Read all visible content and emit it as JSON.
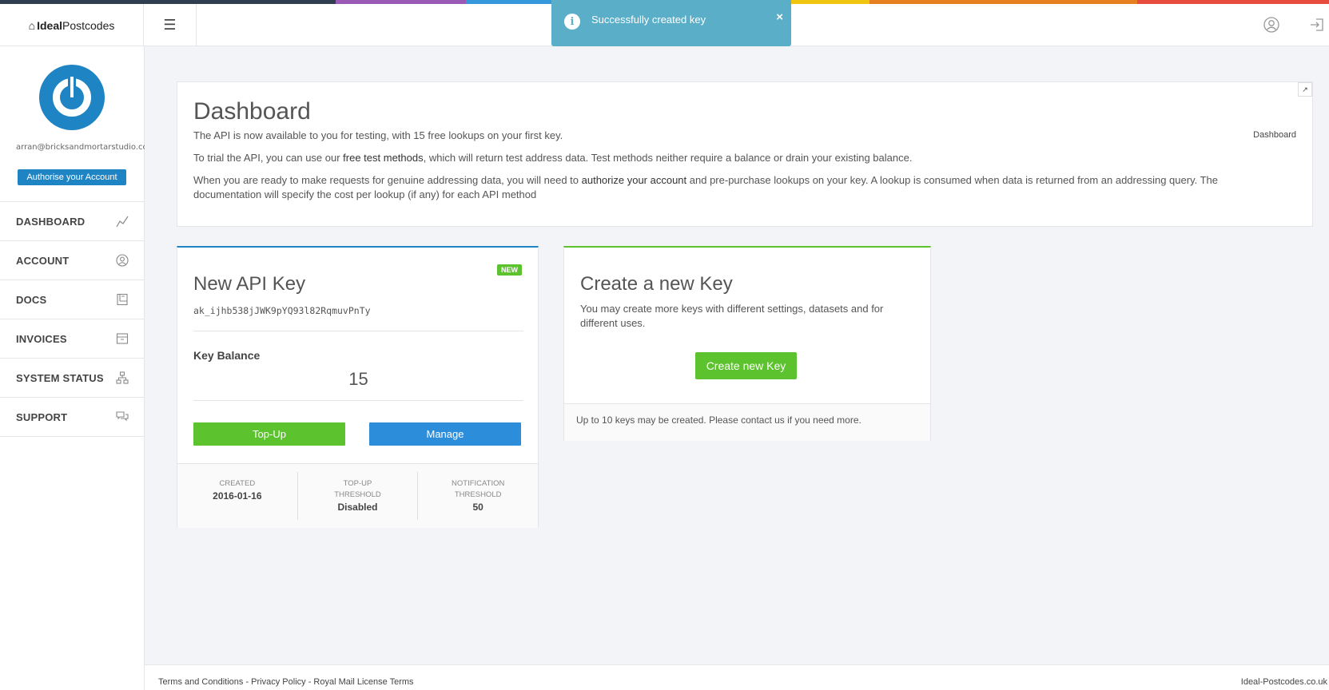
{
  "strip_colors": [
    "#2f3f4f",
    "#2f3f4f",
    "#9b59b6",
    "#3498db",
    "#41a086",
    "#f1c40f",
    "#e67e22",
    "#e74c3c"
  ],
  "header": {
    "brand_bold": "Ideal",
    "brand_rest": "Postcodes",
    "menu_icon": "hamburger-icon",
    "user_icon": "user-icon",
    "logout_icon": "logout-icon"
  },
  "toast": {
    "message": "Successfully created key",
    "icon": "info-icon",
    "close": "×"
  },
  "sidebar": {
    "email": "arran@bricksandmortarstudio.co",
    "authorise_label": "Authorise your Account",
    "items": [
      {
        "label": "DASHBOARD",
        "icon": "chart-line-icon"
      },
      {
        "label": "ACCOUNT",
        "icon": "user-circle-icon"
      },
      {
        "label": "DOCS",
        "icon": "book-icon"
      },
      {
        "label": "INVOICES",
        "icon": "archive-icon"
      },
      {
        "label": "SYSTEM STATUS",
        "icon": "sitemap-icon"
      },
      {
        "label": "SUPPORT",
        "icon": "chat-icon"
      }
    ]
  },
  "dashboard": {
    "title": "Dashboard",
    "breadcrumb": "Dashboard",
    "p1": "The API is now available to you for testing, with 15 free lookups on your first key.",
    "p2_before": "To trial the API, you can use our ",
    "p2_link": "free test methods",
    "p2_after": ", which will return test address data. Test methods neither require a balance or drain your existing balance.",
    "p3_before": "When you are ready to make requests for genuine addressing data, you will need to ",
    "p3_link": "authorize your account",
    "p3_after": " and pre-purchase lookups on your key. A lookup is consumed when data is returned from an addressing query. The documentation will specify the cost per lookup (if any) for each API method"
  },
  "key_card": {
    "title": "New API Key",
    "badge": "NEW",
    "api_key": "ak_ijhb538jJWK9pYQ93l82RqmuvPnTy",
    "balance_label": "Key Balance",
    "balance_value": "15",
    "topup_label": "Top-Up",
    "manage_label": "Manage",
    "stats": [
      {
        "label_line1": "CREATED",
        "label_line2": "",
        "value": "2016-01-16"
      },
      {
        "label_line1": "TOP-UP",
        "label_line2": "THRESHOLD",
        "value": "Disabled"
      },
      {
        "label_line1": "NOTIFICATION",
        "label_line2": "THRESHOLD",
        "value": "50"
      }
    ]
  },
  "new_key_card": {
    "title": "Create a new Key",
    "description": "You may create more keys with different settings, datasets and for different uses.",
    "button_label": "Create new Key",
    "footer_text": "Up to 10 keys may be created. Please contact us if you need more."
  },
  "footer": {
    "terms": "Terms and Conditions",
    "privacy": "Privacy Policy",
    "royal_mail": "Royal Mail License Terms",
    "separator": " - ",
    "site": "Ideal-Postcodes.co.uk"
  }
}
